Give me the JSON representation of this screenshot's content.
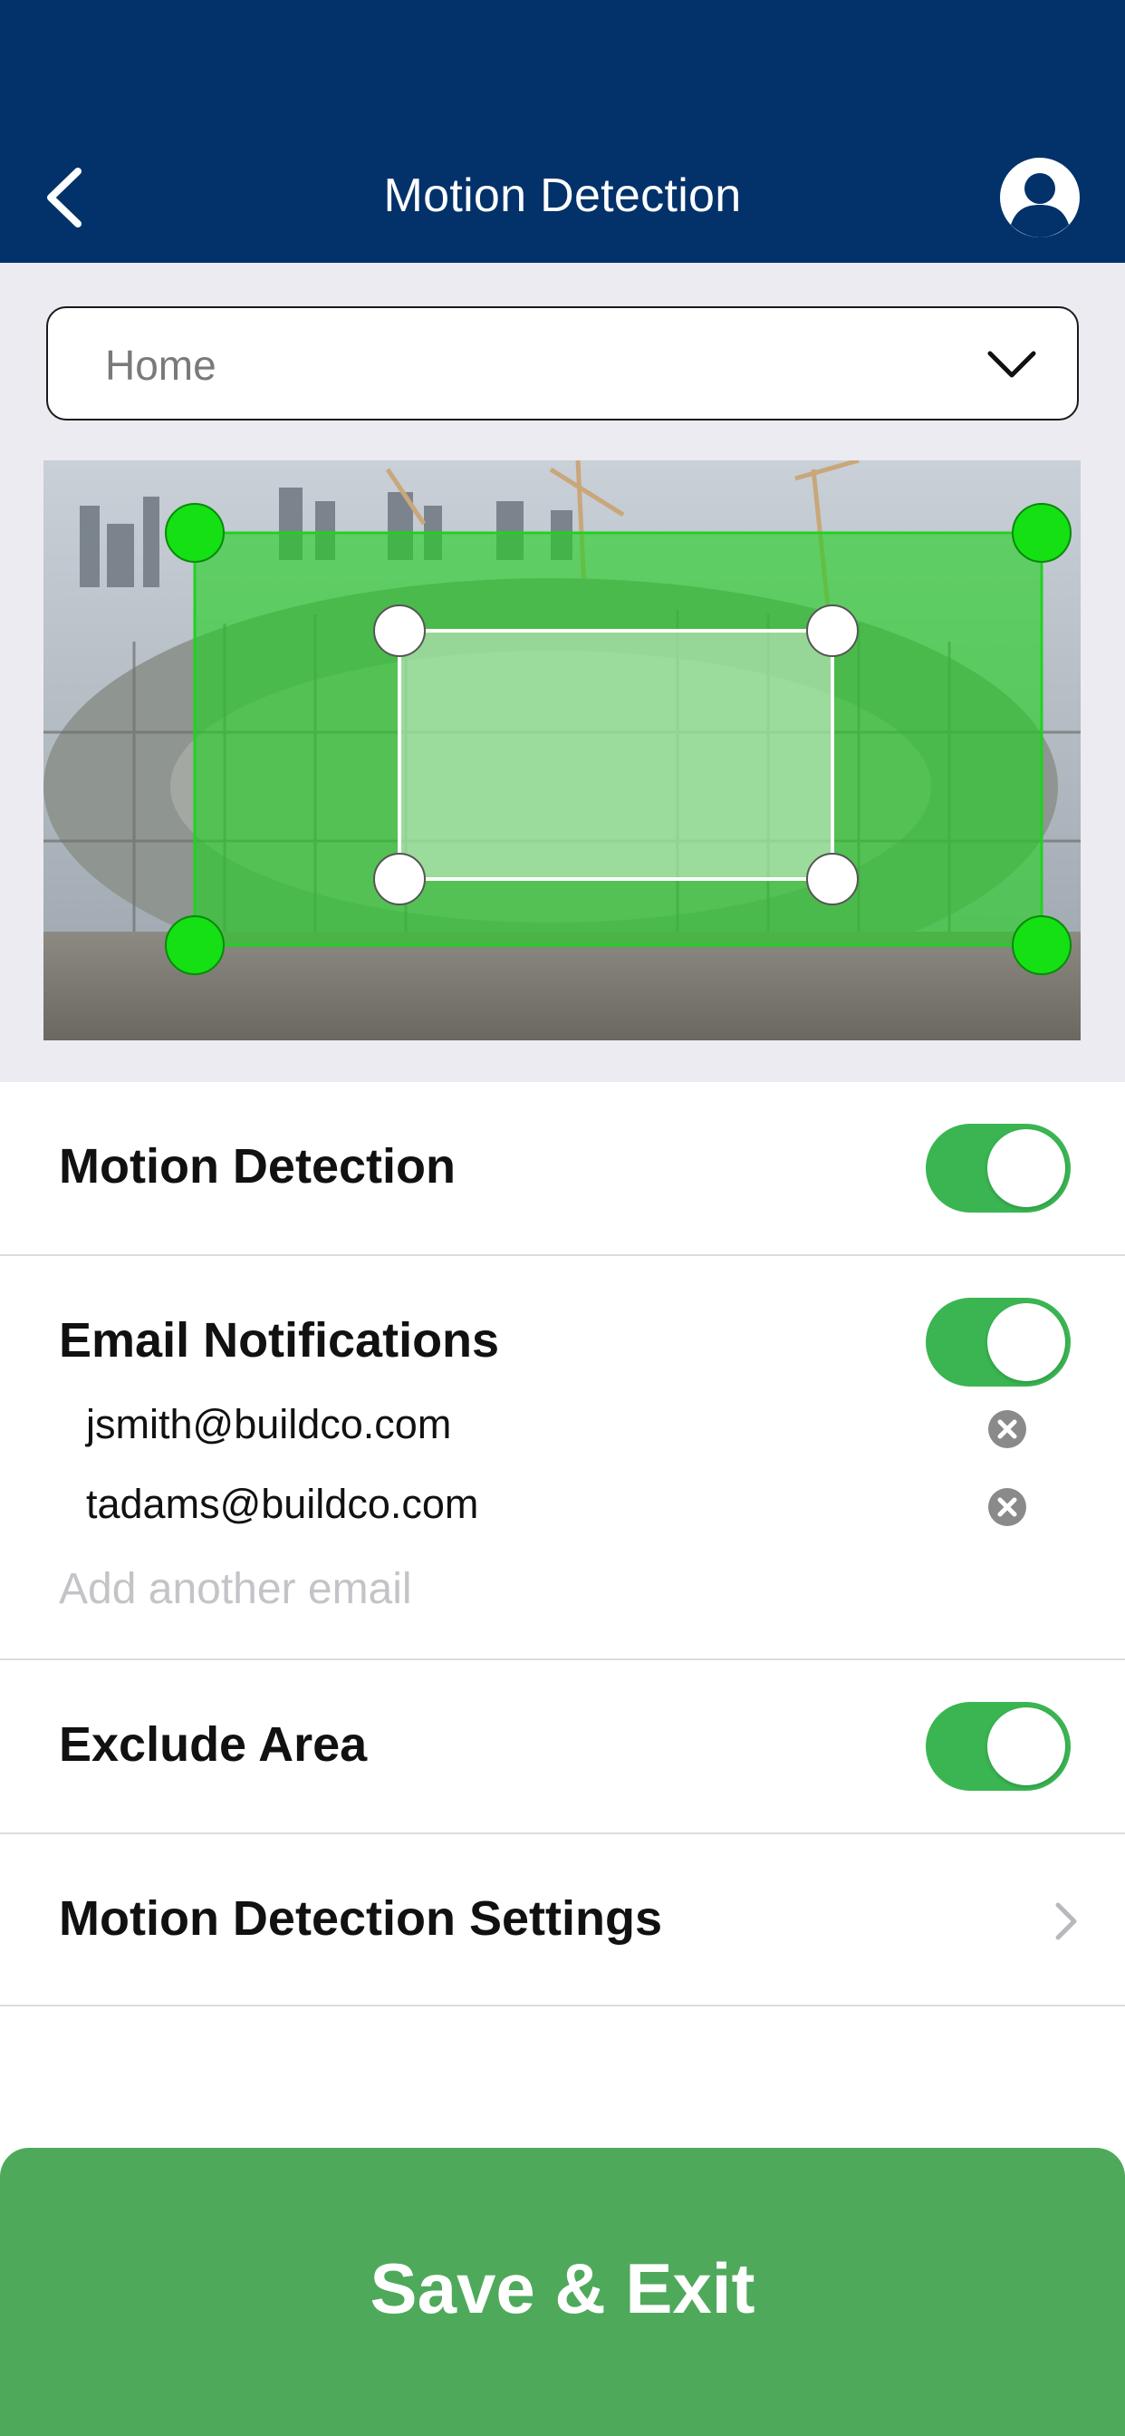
{
  "header": {
    "title": "Motion Detection",
    "back_icon": "chevron-left-icon",
    "account_icon": "user-avatar-icon",
    "color": "#03326a"
  },
  "camera_select": {
    "value": "Home",
    "icon": "chevron-down-icon"
  },
  "camera_view": {
    "detection_zone_color": "#22d122",
    "exclude_zone_color": "#ffffff"
  },
  "settings": {
    "motion_detection": {
      "label": "Motion Detection",
      "enabled": true
    },
    "email_notifications": {
      "label": "Email Notifications",
      "enabled": true,
      "emails": [
        "jsmith@buildco.com",
        "tadams@buildco.com"
      ],
      "add_placeholder": "Add another email"
    },
    "exclude_area": {
      "label": "Exclude Area",
      "enabled": true
    },
    "motion_settings": {
      "label": "Motion Detection Settings"
    }
  },
  "footer": {
    "save_label": "Save & Exit",
    "color": "#4fa95b"
  },
  "colors": {
    "toggle_on": "#3ab552"
  }
}
